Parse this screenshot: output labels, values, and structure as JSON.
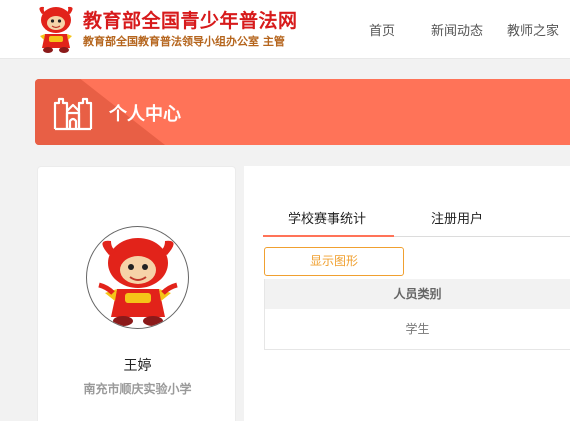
{
  "header": {
    "site_title": "教育部全国青少年普法网",
    "site_subtitle": "教育部全国教育普法领导小组办公室 主管",
    "nav": [
      "首页",
      "新闻动态",
      "教师之家"
    ]
  },
  "banner": {
    "title": "个人中心"
  },
  "profile": {
    "name": "王婷",
    "school": "南充市顺庆实验小学"
  },
  "tabs": [
    "学校赛事统计",
    "注册用户"
  ],
  "show_chart_button": "显示图形",
  "table": {
    "header": "人员类别",
    "rows": [
      "学生"
    ]
  },
  "colors": {
    "accent": "#ff7358",
    "brand_red": "#d71a1b",
    "button_orange": "#f0a030"
  }
}
